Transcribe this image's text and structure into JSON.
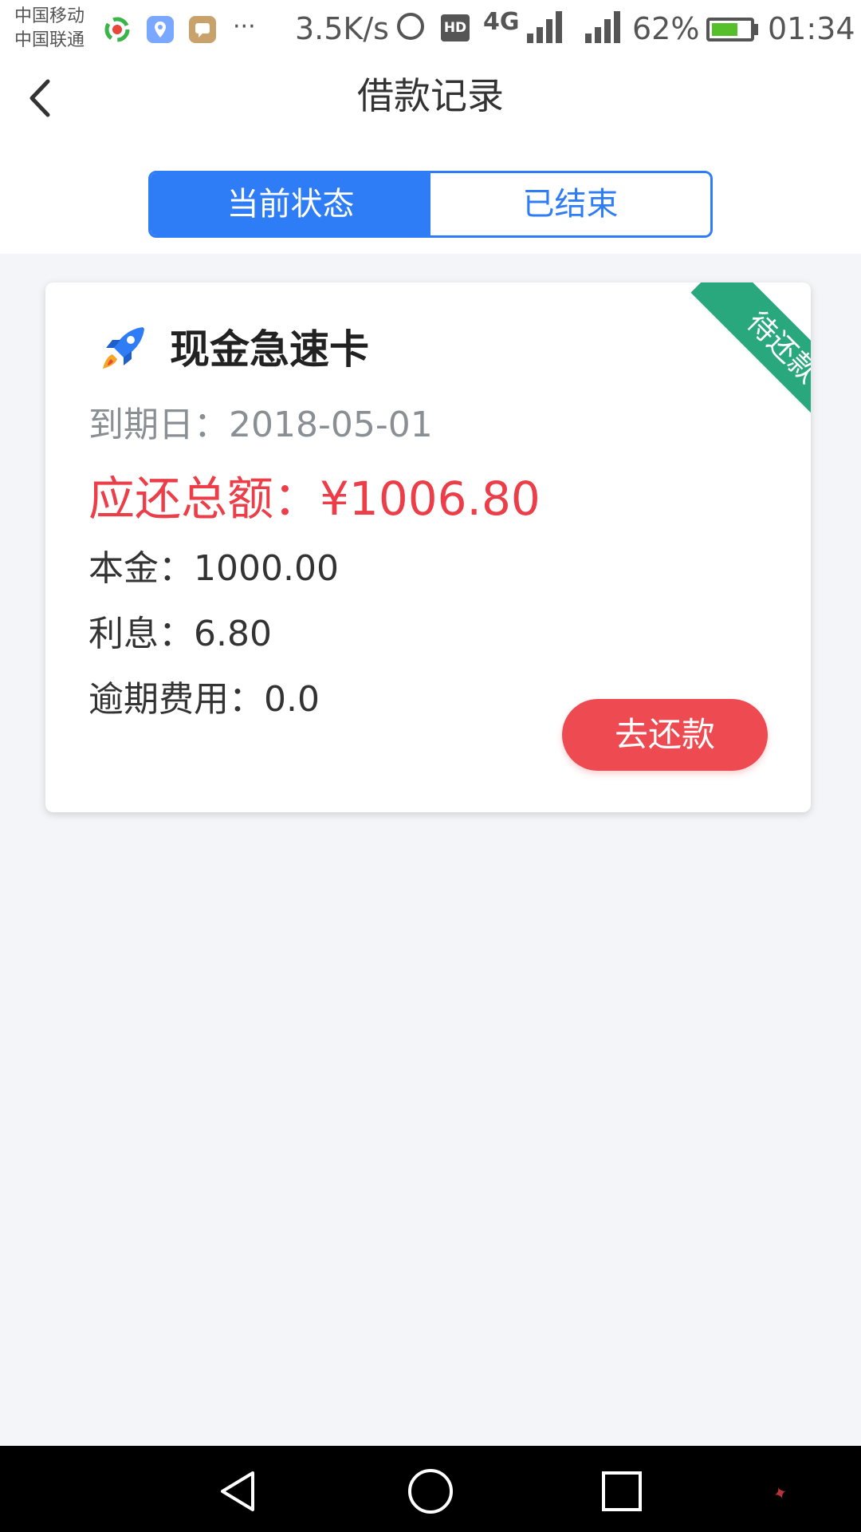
{
  "status_bar": {
    "carrier_1": "中国移动",
    "carrier_2": "中国联通",
    "dots": "···",
    "speed": "3.5K/s",
    "hd": "HD",
    "network": "4G",
    "battery": "62%",
    "time": "01:34",
    "battery_level": 0.62
  },
  "header": {
    "title": "借款记录",
    "back_icon": "chevron-left-icon"
  },
  "tabs": [
    {
      "label": "当前状态",
      "active": true
    },
    {
      "label": "已结束",
      "active": false
    }
  ],
  "loan_card": {
    "icon": "rocket-icon",
    "title": "现金急速卡",
    "status_ribbon": "待还款",
    "due_date_label": "到期日：",
    "due_date": "2018-05-01",
    "total_label": "应还总额：",
    "total_value": "¥1006.80",
    "principal_label": "本金：",
    "principal_value": "1000.00",
    "interest_label": "利息：",
    "interest_value": "6.80",
    "overdue_label": "逾期费用：",
    "overdue_value": "0.0",
    "repay_button": "去还款"
  },
  "colors": {
    "accent_blue": "#2f7df6",
    "alert_red": "#ec3e48",
    "ribbon_green": "#2aa87d",
    "background": "#f4f5f9"
  }
}
